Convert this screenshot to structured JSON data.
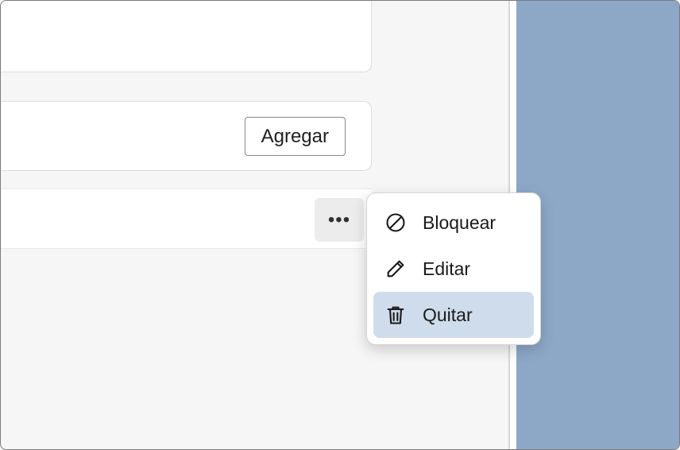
{
  "actions": {
    "add_label": "Agregar"
  },
  "context_menu": {
    "block_label": "Bloquear",
    "edit_label": "Editar",
    "remove_label": "Quitar"
  }
}
